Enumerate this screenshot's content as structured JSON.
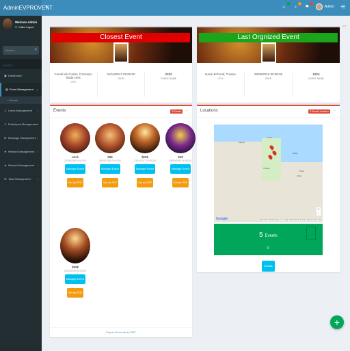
{
  "app": {
    "brand": "AdminEVPROVENT"
  },
  "topnav": {
    "user_name": "Admin",
    "badges": [
      "",
      "",
      ""
    ]
  },
  "sidebar": {
    "user": {
      "name": "Welcom Admin",
      "status": "Online Logout"
    },
    "search_placeholder": "Search...",
    "header": "PLACES",
    "items": [
      {
        "label": "Dashboard",
        "icon": "dashboard-icon",
        "has_children": false,
        "active": false
      },
      {
        "label": "Event Management",
        "icon": "calendar-icon",
        "has_children": true,
        "active": true
      },
      {
        "label": "Users Management",
        "icon": "users-icon",
        "has_children": true,
        "active": false
      },
      {
        "label": "Participant Management",
        "icon": "participant-icon",
        "has_children": true,
        "active": false
      },
      {
        "label": "Message Management",
        "icon": "message-icon",
        "has_children": true,
        "active": false
      },
      {
        "label": "Reward Management",
        "icon": "reward-icon",
        "has_children": true,
        "active": false
      },
      {
        "label": "Reward Management",
        "icon": "reward-icon",
        "has_children": true,
        "active": false
      },
      {
        "label": "Task Management",
        "icon": "task-icon",
        "has_children": true,
        "active": false
      }
    ],
    "sub_items": [
      "Events"
    ]
  },
  "closest": {
    "title": "Closest Event",
    "city_value": "Comté de Custer, Colorado, États-Unis",
    "city_label": "CITY",
    "date_value": "01/10/2017 00:00:00",
    "date_label": "DATE",
    "name_value": "$$$$",
    "name_label": "EVENT NAME",
    "stripe_color": "#e00000"
  },
  "last": {
    "title": "Last Orgnized Event",
    "city_value": "Hassi El Ferid, Tunisie",
    "city_label": "CITY",
    "date_value": "28/09/2016 00:00:00",
    "date_label": "DATE",
    "name_value": "$$$$",
    "name_label": "EVENT NAME",
    "stripe_color": "#1aa51a"
  },
  "events_box": {
    "title": "Events",
    "label": "5 Events",
    "items": [
      {
        "name": "salah",
        "date": "22/09/2016 00:00:00"
      },
      {
        "name": "$$$",
        "date": "08/09/2016 00:00:00"
      },
      {
        "name": "$$$$",
        "date": "13/10/2017 00:00:00"
      },
      {
        "name": "$$$",
        "date": "08/09/2016 00:00:00"
      },
      {
        "name": "$$$$",
        "date": "28/09/2016 00:00:00"
      }
    ],
    "manage_label": "Manage Event",
    "pdf_label": "Get as PDF",
    "export_link": "Export all events to PDF"
  },
  "locations_box": {
    "title": "Locations",
    "label": "5 Events Location",
    "map_labels": [
      "Tunis",
      "Malte",
      "Algérie",
      "Tunisie",
      "Tripoli",
      "Libye"
    ],
    "map_attribution": "Map data ©2016 Google, Inst. Geogr. Nacional  Map & Terms  Report a map error",
    "count": "5",
    "count_label": "Events",
    "count_sub": "0",
    "details_label": "Details"
  },
  "colors": {
    "header": "#3c8dbc",
    "sidebar": "#222d32",
    "green": "#00a65a",
    "cyan": "#00c0ef",
    "orange": "#f39c12",
    "red": "#dd4b39"
  }
}
